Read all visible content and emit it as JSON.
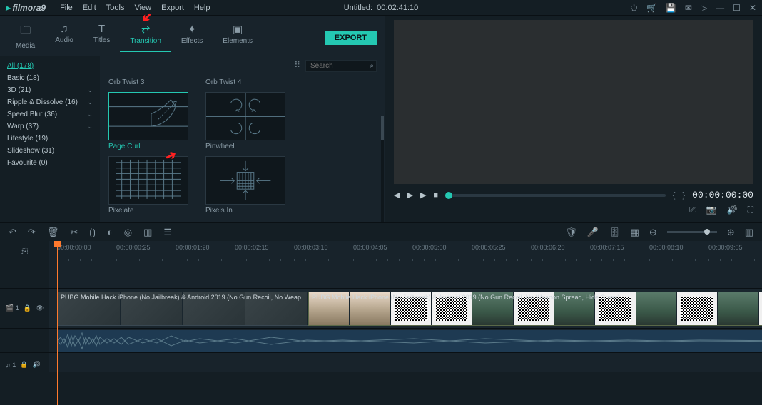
{
  "app": {
    "name": "filmora9",
    "project_title": "Untitled:",
    "project_duration": "00:02:41:10"
  },
  "menus": [
    "File",
    "Edit",
    "Tools",
    "View",
    "Export",
    "Help"
  ],
  "media_tabs": [
    {
      "label": "Media",
      "icon": "📁"
    },
    {
      "label": "Audio",
      "icon": "🎵"
    },
    {
      "label": "Titles",
      "icon": "T"
    },
    {
      "label": "Transition",
      "icon": "⇄"
    },
    {
      "label": "Effects",
      "icon": "✦"
    },
    {
      "label": "Elements",
      "icon": "▣"
    }
  ],
  "export_label": "EXPORT",
  "categories": [
    {
      "label": "All (178)",
      "type": "all"
    },
    {
      "label": "Basic (18)",
      "type": "basic"
    },
    {
      "label": "3D (21)",
      "expand": true
    },
    {
      "label": "Ripple & Dissolve (16)",
      "expand": true
    },
    {
      "label": "Speed Blur (36)",
      "expand": true
    },
    {
      "label": "Warp (37)",
      "expand": true
    },
    {
      "label": "Lifestyle (19)"
    },
    {
      "label": "Slideshow (31)"
    },
    {
      "label": "Favourite (0)"
    }
  ],
  "search": {
    "placeholder": "Search"
  },
  "transitions": {
    "orb3": "Orb Twist 3",
    "orb4": "Orb Twist 4",
    "pagecurl": "Page Curl",
    "pinwheel": "Pinwheel",
    "pixelate": "Pixelate",
    "pixelsin": "Pixels In"
  },
  "preview": {
    "timecode": "00:00:00:00"
  },
  "ruler": {
    "marks": [
      "00:00:00:00",
      "00:00:00:25",
      "00:00:01:20",
      "00:00:02:15",
      "00:00:03:10",
      "00:00:04:05",
      "00:00:05:00",
      "00:00:05:25",
      "00:00:06:20",
      "00:00:07:15",
      "00:00:08:10",
      "00:00:09:05"
    ]
  },
  "tracks": {
    "video_label": "🎬 1",
    "audio_label": "♫ 1"
  },
  "clips": {
    "clip1": "PUBG Mobile Hack iPhone (No Jailbreak) & Android 2019 (No Gun Recoil, No Weap",
    "clip2": "PUBG Mobile Hack iPhone (No Jailbreak) & Android 2019 (No Gun Recoil, No Weapon Spread, Hide Grass)"
  }
}
